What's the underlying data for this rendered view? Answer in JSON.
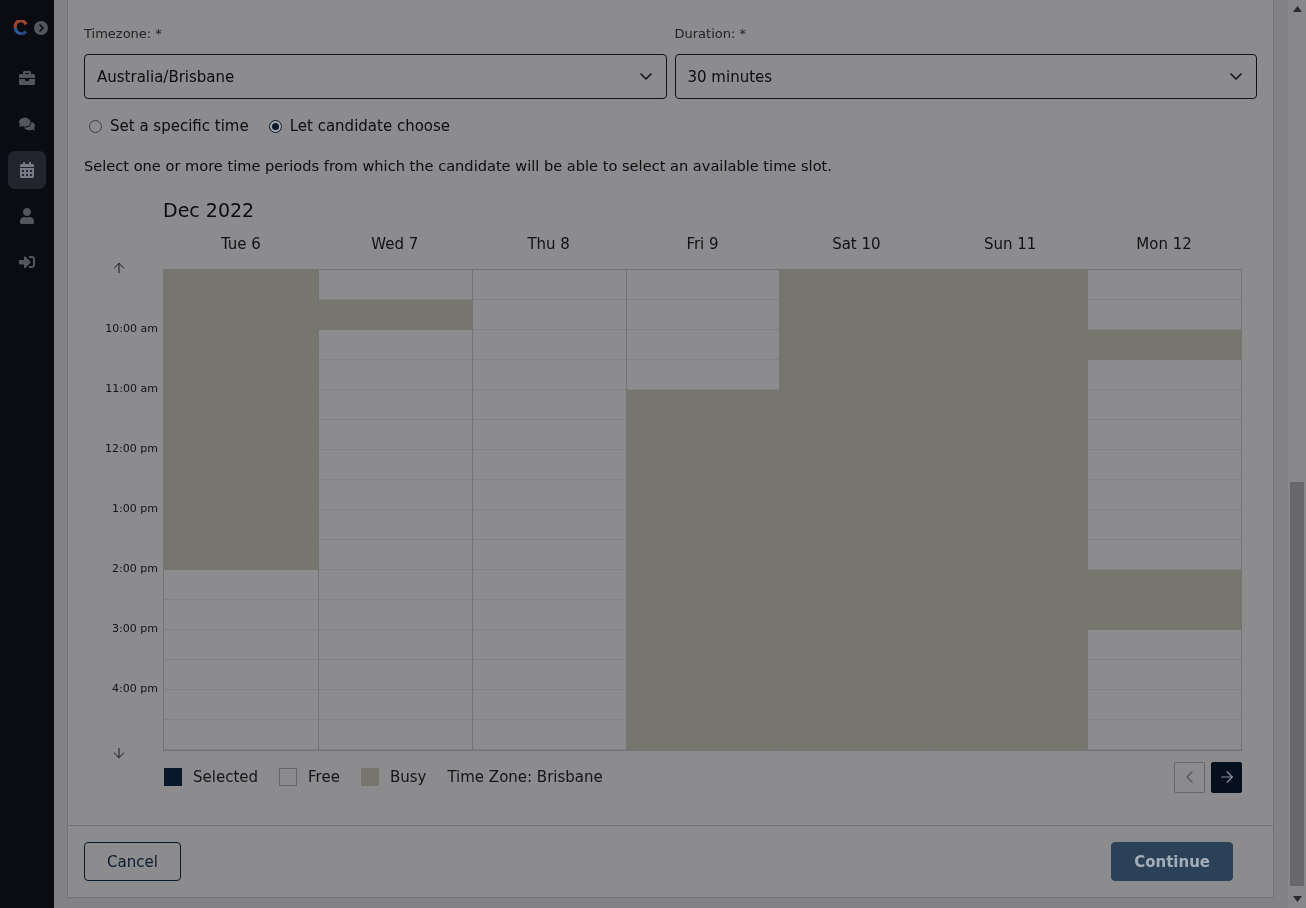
{
  "sidebar": {
    "items": [
      {
        "selected": false
      },
      {
        "selected": false
      },
      {
        "selected": true
      },
      {
        "selected": false
      },
      {
        "selected": false
      }
    ]
  },
  "form": {
    "timezone": {
      "label": "Timezone: *",
      "value": "Australia/Brisbane"
    },
    "duration": {
      "label": "Duration: *",
      "value": "30 minutes"
    },
    "mode_options": [
      {
        "label": "Set a specific time",
        "selected": false
      },
      {
        "label": "Let candidate choose",
        "selected": true
      }
    ],
    "instructions": "Select one or more time periods from which the candidate will be able to select an available time slot."
  },
  "calendar": {
    "month": "Dec 2022",
    "time_labels": [
      "10:00 am",
      "11:00 am",
      "12:00 pm",
      "1:00 pm",
      "2:00 pm",
      "3:00 pm",
      "4:00 pm"
    ],
    "days": [
      {
        "label": "Tue 6",
        "slots": [
          {
            "busy": true
          },
          {
            "busy": true
          },
          {
            "busy": true
          },
          {
            "busy": true
          },
          {
            "busy": true
          },
          {
            "busy": true
          },
          {
            "busy": true
          },
          {
            "busy": true
          },
          {
            "busy": true
          },
          {
            "busy": true
          },
          {
            "busy": false
          },
          {
            "busy": false
          },
          {
            "busy": false
          },
          {
            "busy": false
          },
          {
            "busy": false
          },
          {
            "busy": false
          }
        ]
      },
      {
        "label": "Wed 7",
        "slots": [
          {
            "busy": false
          },
          {
            "busy": true
          },
          {
            "busy": false
          },
          {
            "busy": false
          },
          {
            "busy": false
          },
          {
            "busy": false
          },
          {
            "busy": false
          },
          {
            "busy": false
          },
          {
            "busy": false
          },
          {
            "busy": false
          },
          {
            "busy": false
          },
          {
            "busy": false
          },
          {
            "busy": false
          },
          {
            "busy": false
          },
          {
            "busy": false
          },
          {
            "busy": false
          }
        ]
      },
      {
        "label": "Thu 8",
        "slots": [
          {
            "busy": false
          },
          {
            "busy": false
          },
          {
            "busy": false
          },
          {
            "busy": false
          },
          {
            "busy": false
          },
          {
            "busy": false
          },
          {
            "busy": false
          },
          {
            "busy": false
          },
          {
            "busy": false
          },
          {
            "busy": false
          },
          {
            "busy": false
          },
          {
            "busy": false
          },
          {
            "busy": false
          },
          {
            "busy": false
          },
          {
            "busy": false
          },
          {
            "busy": false
          }
        ]
      },
      {
        "label": "Fri 9",
        "slots": [
          {
            "busy": false
          },
          {
            "busy": false
          },
          {
            "busy": false
          },
          {
            "busy": false
          },
          {
            "busy": true
          },
          {
            "busy": true
          },
          {
            "busy": true
          },
          {
            "busy": true
          },
          {
            "busy": true
          },
          {
            "busy": true
          },
          {
            "busy": true
          },
          {
            "busy": true
          },
          {
            "busy": true
          },
          {
            "busy": true
          },
          {
            "busy": true
          },
          {
            "busy": true
          }
        ]
      },
      {
        "label": "Sat 10",
        "slots": [
          {
            "busy": true
          },
          {
            "busy": true
          },
          {
            "busy": true
          },
          {
            "busy": true
          },
          {
            "busy": true
          },
          {
            "busy": true
          },
          {
            "busy": true
          },
          {
            "busy": true
          },
          {
            "busy": true
          },
          {
            "busy": true
          },
          {
            "busy": true
          },
          {
            "busy": true
          },
          {
            "busy": true
          },
          {
            "busy": true
          },
          {
            "busy": true
          },
          {
            "busy": true
          }
        ]
      },
      {
        "label": "Sun 11",
        "slots": [
          {
            "busy": true
          },
          {
            "busy": true
          },
          {
            "busy": true
          },
          {
            "busy": true
          },
          {
            "busy": true
          },
          {
            "busy": true
          },
          {
            "busy": true
          },
          {
            "busy": true
          },
          {
            "busy": true
          },
          {
            "busy": true
          },
          {
            "busy": true
          },
          {
            "busy": true
          },
          {
            "busy": true
          },
          {
            "busy": true
          },
          {
            "busy": true
          },
          {
            "busy": true
          }
        ]
      },
      {
        "label": "Mon 12",
        "slots": [
          {
            "busy": false
          },
          {
            "busy": false
          },
          {
            "busy": true
          },
          {
            "busy": false
          },
          {
            "busy": false
          },
          {
            "busy": false
          },
          {
            "busy": false
          },
          {
            "busy": false
          },
          {
            "busy": false
          },
          {
            "busy": false
          },
          {
            "busy": true
          },
          {
            "busy": true
          },
          {
            "busy": false
          },
          {
            "busy": false
          },
          {
            "busy": false
          },
          {
            "busy": false
          }
        ]
      }
    ],
    "legend": [
      {
        "kind": "selected",
        "label": "Selected",
        "color": "#07182b"
      },
      {
        "kind": "free",
        "label": "Free",
        "color": "#8c8c8e"
      },
      {
        "kind": "busy",
        "label": "Busy",
        "color": "#76766f"
      }
    ],
    "timezone_note": "Time Zone: Brisbane",
    "nav": {
      "previous": {
        "disabled": true
      },
      "next": {
        "disabled": false
      }
    }
  },
  "footer": {
    "buttons": [
      {
        "kind": "secondary",
        "label": "Cancel",
        "disabled": false
      },
      {
        "kind": "primary",
        "label": "Continue",
        "disabled": true
      }
    ]
  }
}
